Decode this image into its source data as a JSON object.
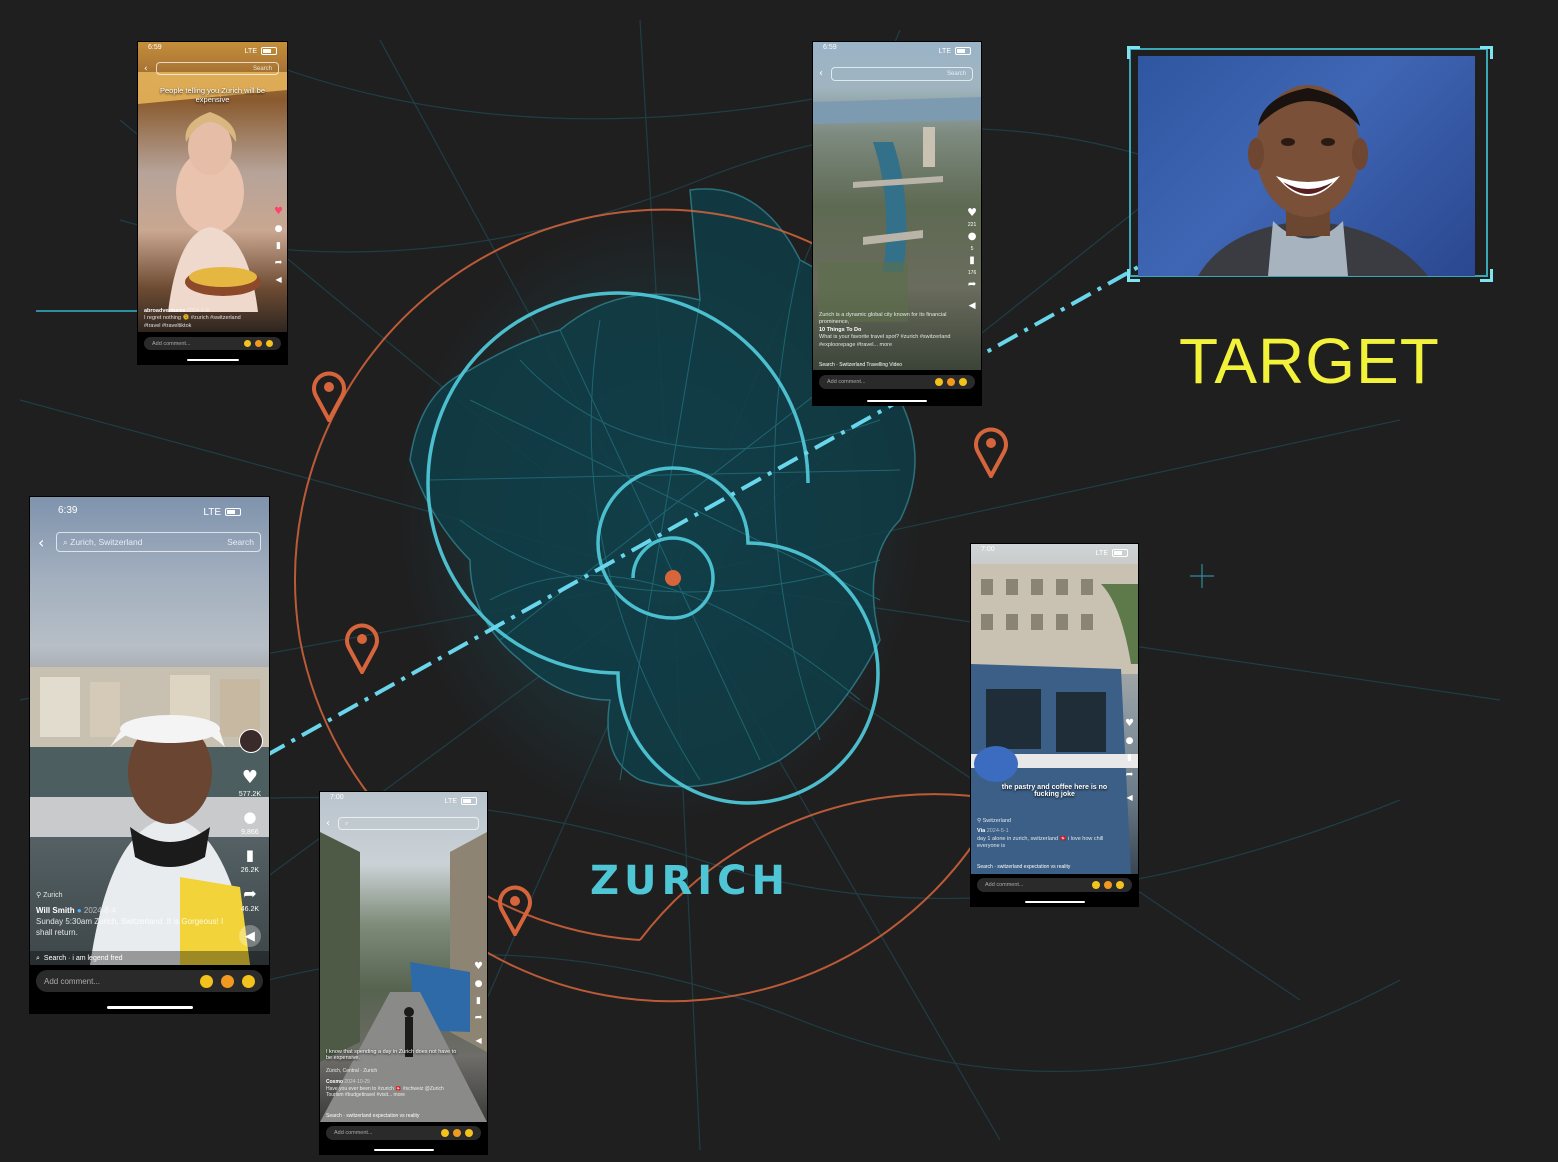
{
  "colors": {
    "background": "#1f1f20",
    "map_cyan": "#4fc6d6",
    "orbit_orange": "#d7653c",
    "pin_orange": "#d7653c",
    "target_yellow": "#f2f23a",
    "trace_line": "#6ad6ec"
  },
  "map": {
    "city_label": "ZURICH"
  },
  "target": {
    "label": "TARGET"
  },
  "icons": {
    "pin": "map-pin-icon",
    "heart": "heart-icon",
    "comment": "comment-icon",
    "bookmark": "bookmark-icon",
    "share": "share-icon",
    "mute": "mute-icon",
    "search": "search-icon",
    "back": "back-arrow-icon",
    "location": "location-icon"
  },
  "phones": {
    "fondue": {
      "time": "6:59",
      "network": "LTE",
      "search_text": "Search",
      "overlay": "People telling you Zurich will be expensive",
      "username": "abroadventures",
      "date": "2024-7-9",
      "caption": "I regret nothing 🫠 #zurich #switzerland #travel #traveltiktok",
      "comment_placeholder": "Add comment..."
    },
    "aerial": {
      "time": "6:59",
      "network": "LTE",
      "search_text": "Search",
      "likes": "221",
      "comments": "5",
      "saves": "176",
      "caption_title": "Zurich is a dynamic global city known for its financial prominence,",
      "username": "10 Things To Do",
      "caption": "What is your favorite travel spot? #zurich #switzerland #exploorepage #travel... more",
      "search_strip": "Search · Switzerland Travelling Video",
      "comment_placeholder": "Add comment..."
    },
    "willsmith": {
      "time": "6:39",
      "network": "LTE",
      "search_query": "Zurich, Switzerland",
      "search_button": "Search",
      "likes": "577.2K",
      "comments": "9,866",
      "saves": "26.2K",
      "shares": "46.2K",
      "location": "Zurich",
      "username": "Will Smith",
      "date": "2024-8-4",
      "caption": "Sunday 5:30am Zurich, Switzerland.  It is Gorgeous!  I shall return.",
      "search_strip": "Search · i am legend fred",
      "comment_placeholder": "Add comment..."
    },
    "tram": {
      "time": "7:00",
      "network": "LTE",
      "overlay": "the pastry and coffee here is no fucking joke",
      "location": "Switzerland",
      "username": "Via",
      "date": "2024-5-1",
      "caption": "day 1 alone in zurich, switzerland 🇨🇭 i love how chill everyone is",
      "search_strip": "Search · switzerland expectation vs reality",
      "comment_placeholder": "Add comment..."
    },
    "street": {
      "time": "7:00",
      "network": "LTE",
      "overlay": "I know that spending a day in Zurich does not have to be expensive.",
      "location": "Zürich, Central · Zurich",
      "username": "Cosmo",
      "date": "2024-10-25",
      "caption": "Have you ever been to #zurich 🇨🇭 #schweiz @Zurich Tourism #budgettravel #visit... more",
      "search_strip": "Search · switzerland expectation vs reality",
      "comment_placeholder": "Add comment..."
    }
  }
}
